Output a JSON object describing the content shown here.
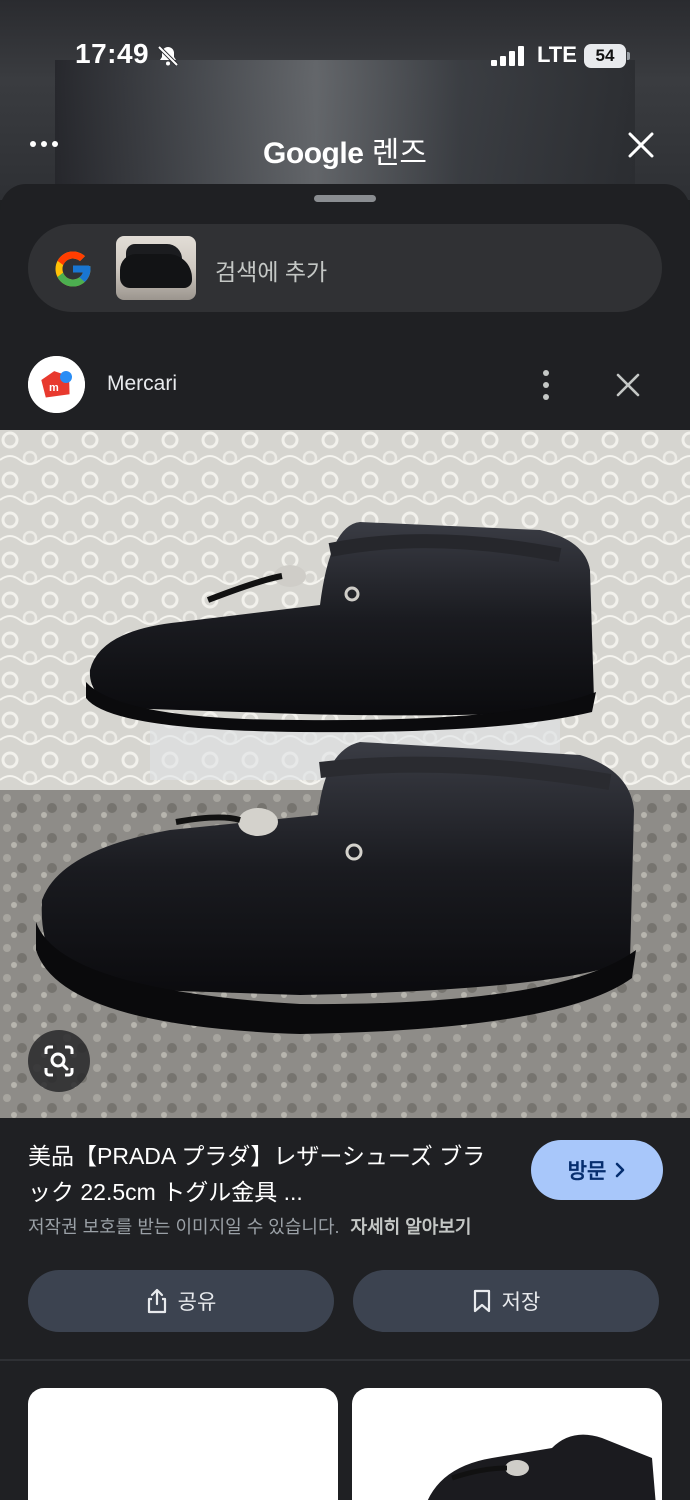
{
  "status": {
    "time": "17:49",
    "network": "LTE",
    "battery": "54"
  },
  "header": {
    "title_brand": "Google",
    "title_suffix": " 렌즈"
  },
  "search": {
    "placeholder": "검색에 추가"
  },
  "source": {
    "name": "Mercari"
  },
  "result": {
    "title": "美品【PRADA プラダ】レザーシューズ ブラック 22.5cm トグル金具 ...",
    "visit_label": "방문",
    "copyright_note": "저작권 보호를 받는 이미지일 수 있습니다.",
    "learn_more": "자세히 알아보기"
  },
  "actions": {
    "share_label": "공유",
    "save_label": "저장"
  },
  "colors": {
    "accent": "#a8c7fa",
    "sheet_bg": "#1f2023",
    "pill_bg": "#303134",
    "action_bg": "#3c4350"
  },
  "icons": [
    "bell-slash-icon",
    "signal-icon",
    "menu-dots-icon",
    "close-icon",
    "google-g-icon",
    "kebab-icon",
    "lens-search-icon",
    "chevron-right-icon",
    "share-icon",
    "bookmark-icon"
  ]
}
